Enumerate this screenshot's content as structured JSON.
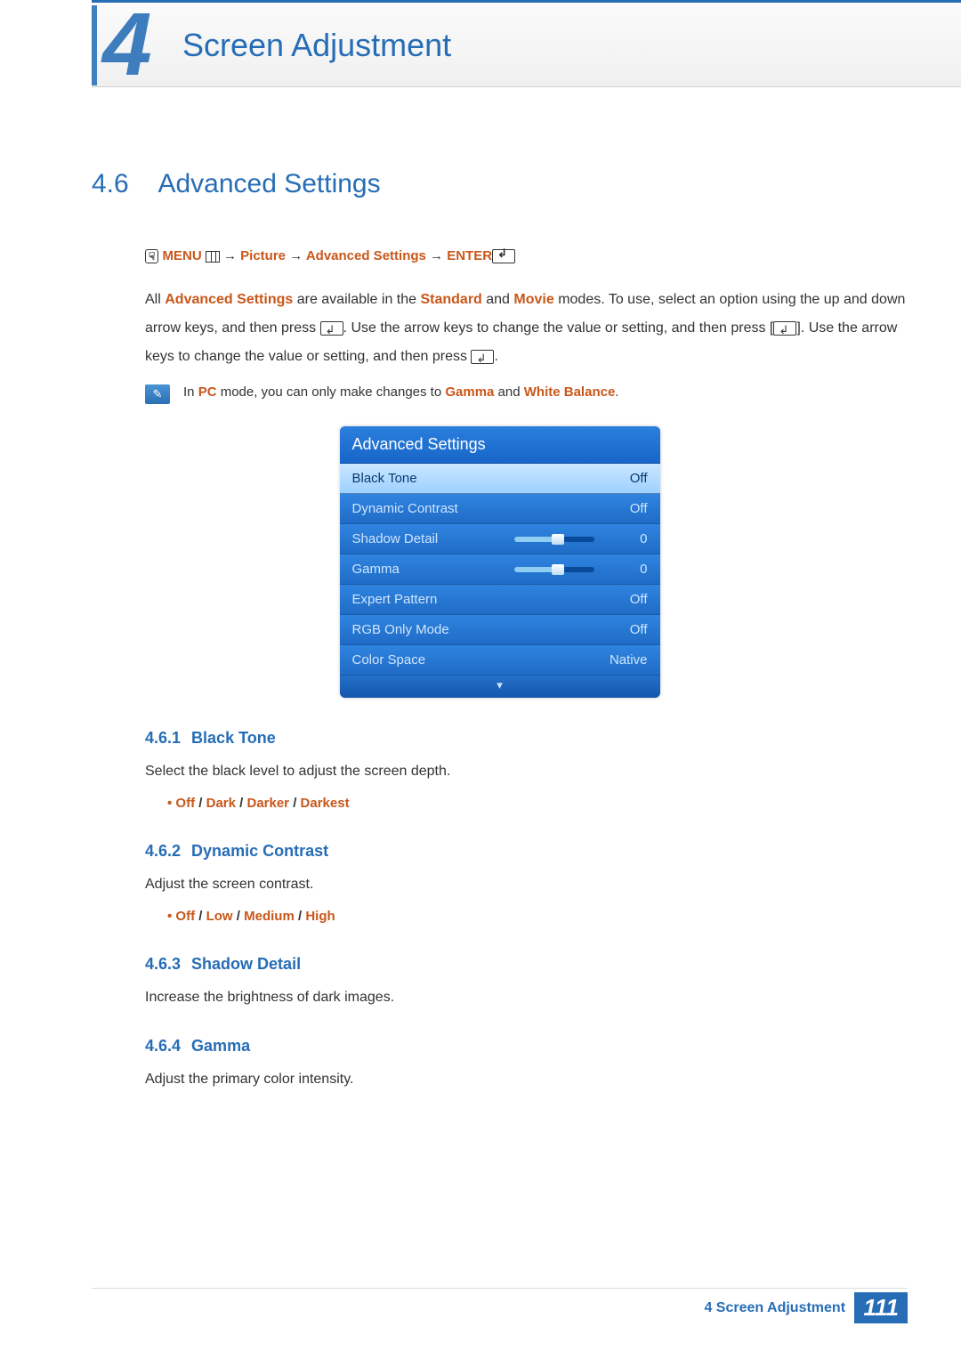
{
  "chapter": {
    "number": "4",
    "title": "Screen Adjustment"
  },
  "section": {
    "number": "4.6",
    "title": "Advanced Settings"
  },
  "nav": {
    "menu": "MENU",
    "picture": "Picture",
    "adv": "Advanced Settings",
    "enter": "ENTER",
    "arrow": "→"
  },
  "intro": {
    "p1_a": "All ",
    "p1_b": "Advanced Settings",
    "p1_c": " are available in the ",
    "p1_d": "Standard",
    "p1_e": " and ",
    "p1_f": "Movie",
    "p1_g": " modes. To use, select an option using the up and down arrow keys, and then press ",
    "p1_h": ". Use the arrow keys to change the value or setting, and then press [",
    "p1_i": "]. Use the arrow keys to change the value or setting, and then press ",
    "p1_j": "."
  },
  "note": {
    "a": "In ",
    "b": "PC",
    "c": " mode, you can only make changes to ",
    "d": "Gamma",
    "e": " and ",
    "f": "White Balance",
    "g": "."
  },
  "osd": {
    "title": "Advanced Settings",
    "items": [
      {
        "label": "Black Tone",
        "value": "Off",
        "selected": true,
        "slider": false
      },
      {
        "label": "Dynamic Contrast",
        "value": "Off",
        "selected": false,
        "slider": false
      },
      {
        "label": "Shadow Detail",
        "value": "0",
        "selected": false,
        "slider": true
      },
      {
        "label": "Gamma",
        "value": "0",
        "selected": false,
        "slider": true
      },
      {
        "label": "Expert Pattern",
        "value": "Off",
        "selected": false,
        "slider": false
      },
      {
        "label": "RGB Only Mode",
        "value": "Off",
        "selected": false,
        "slider": false
      },
      {
        "label": "Color Space",
        "value": "Native",
        "selected": false,
        "slider": false
      }
    ]
  },
  "subs": {
    "s1": {
      "num": "4.6.1",
      "title": "Black Tone",
      "desc": "Select the black level to adjust the screen depth.",
      "opts": [
        "Off",
        "Dark",
        "Darker",
        "Darkest"
      ]
    },
    "s2": {
      "num": "4.6.2",
      "title": "Dynamic Contrast",
      "desc": "Adjust the screen contrast.",
      "opts": [
        "Off",
        "Low",
        "Medium",
        "High"
      ]
    },
    "s3": {
      "num": "4.6.3",
      "title": "Shadow Detail",
      "desc": "Increase the brightness of dark images."
    },
    "s4": {
      "num": "4.6.4",
      "title": "Gamma",
      "desc": "Adjust the primary color intensity."
    }
  },
  "footer": {
    "trail_prefix": "4",
    "trail_title": "Screen Adjustment",
    "page": "111"
  }
}
